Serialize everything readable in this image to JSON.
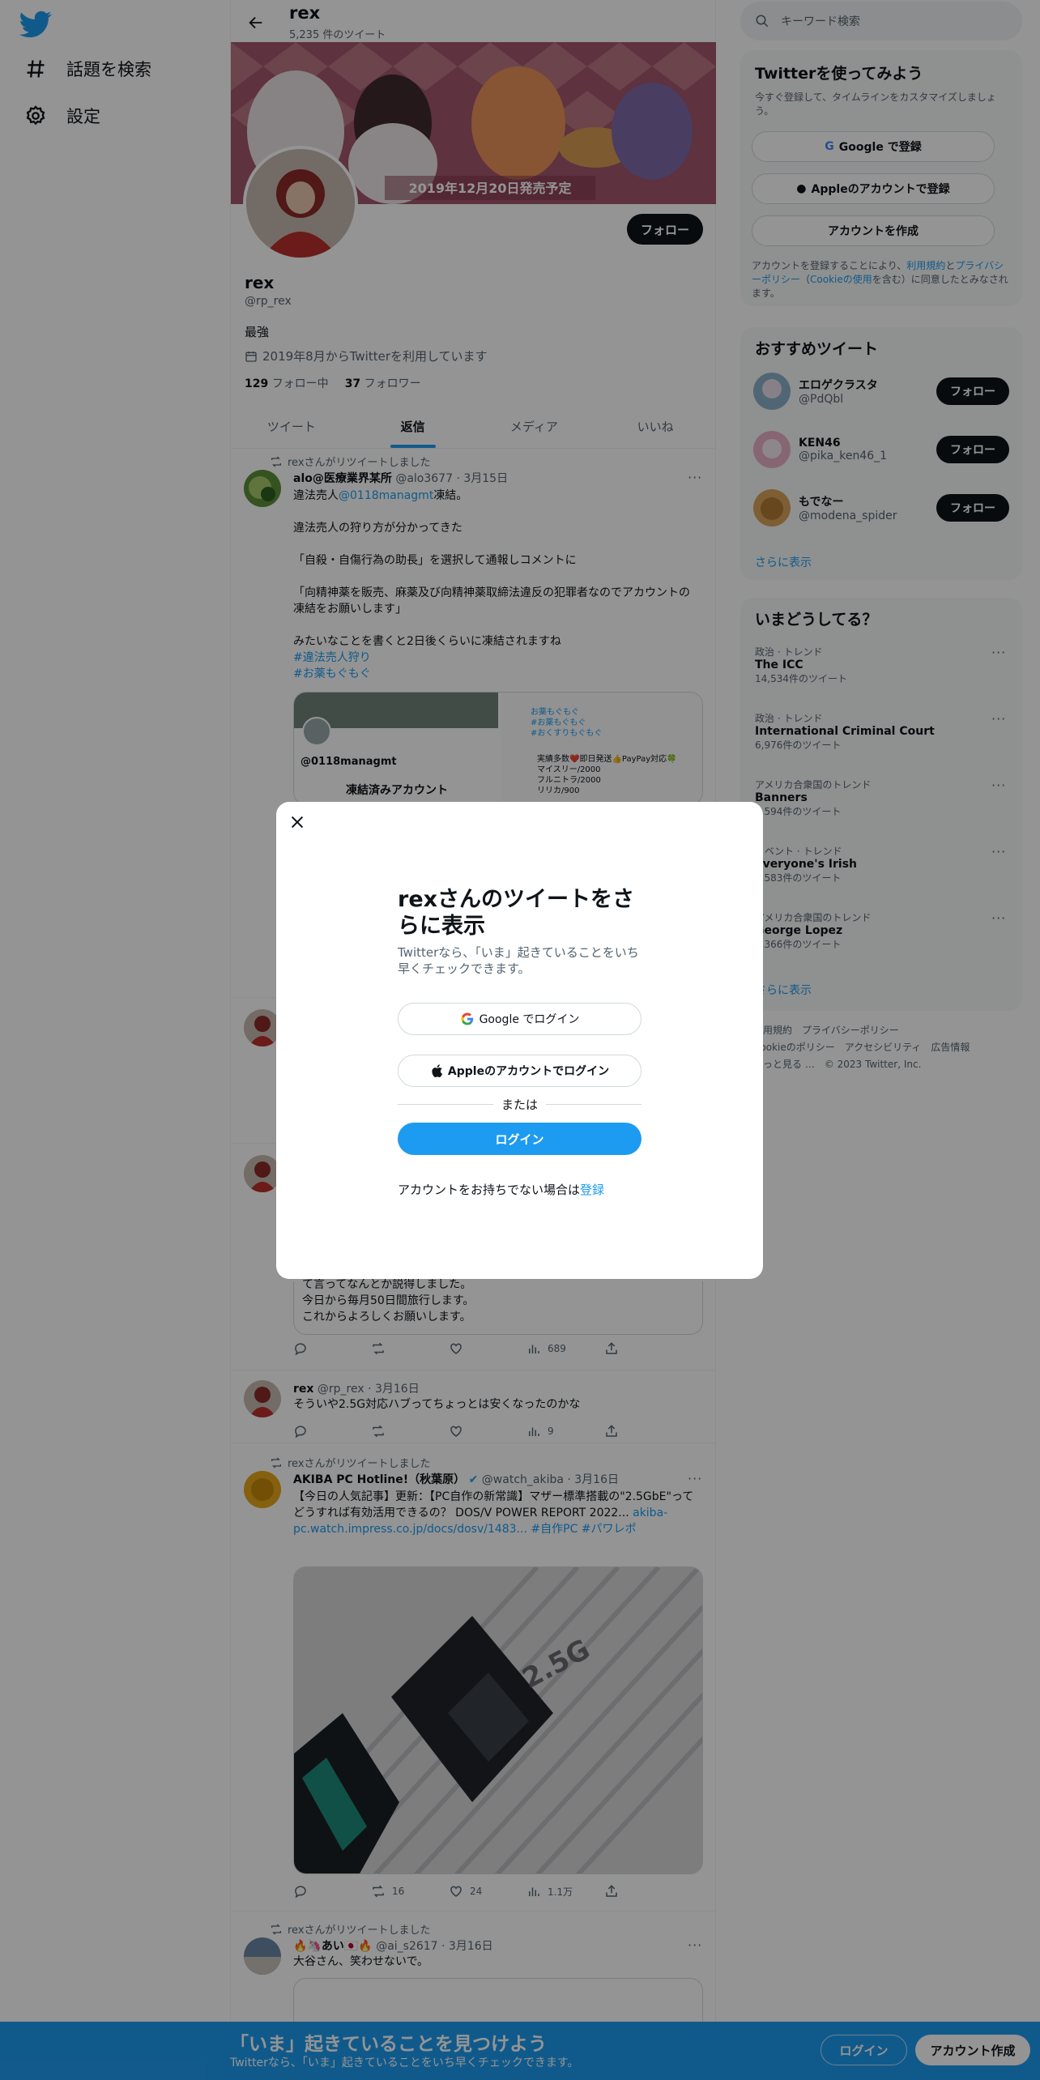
{
  "nav": {
    "explore_label": "話題を検索",
    "settings_label": "設定"
  },
  "header": {
    "title": "rex",
    "tweet_count": "5,235 件のツイート"
  },
  "banner": {
    "caption": "2019年12月20日発売予定"
  },
  "profile": {
    "follow_label": "フォロー",
    "name": "rex",
    "handle": "@rp_rex",
    "bio": "最強",
    "joined": "2019年8月からTwitterを利用しています",
    "following_count": "129",
    "following_label": "フォロー中",
    "followers_count": "37",
    "followers_label": "フォロワー"
  },
  "tabs": [
    {
      "label": "ツイート"
    },
    {
      "label": "返信"
    },
    {
      "label": "メディア"
    },
    {
      "label": "いいね"
    }
  ],
  "tweets": [
    {
      "retweet_by": "rexさんがリツイートしました",
      "name": "alo@医療業界某所",
      "handle_date": "@alo3677 · 3月15日",
      "text_pre": "違法売人",
      "mention": "@0118managmt",
      "text_post": "凍結。",
      "body": "違法売人の狩り方が分かってきた\n\n「自殺・自傷行為の助長」を選択して通報しコメントに\n\n「向精神薬を販売、麻薬及び向精神薬取締法違反の犯罪者なのでアカウントの凍結をお願いします」\n\nみたいなことを書くと2日後くらいに凍結されますね",
      "hashtag1": "#違法売人狩り",
      "hashtag2": "#お薬もぐもぐ",
      "image_handle": "@0118managmt",
      "image_suspended": "凍結済みアカウント",
      "image_tags": "お薬もぐもぐ\n#お薬もぐもぐ\n#おくすりもぐもぐ",
      "image_post": "実績多数❤️即日発送👍PayPay対応🍀\nマイスリー/2000\nフルニトラ/2000\nリリカ/900"
    },
    {
      "body_tail": "て言ってなんとか説得しました。\n今日から毎月50日間旅行します。\nこれからよろしくお願いします。",
      "views": "689"
    },
    {
      "name": "rex",
      "handle_date": "@rp_rex · 3月16日",
      "body": "そういや2.5G対応ハブってちょっとは安くなったのかな",
      "views": "9"
    },
    {
      "retweet_by": "rexさんがリツイートしました",
      "name": "AKIBA PC Hotline!（秋葉原）",
      "handle_date": "@watch_akiba · 3月16日",
      "body": "【今日の人気記事】更新：【PC自作の新常識】マザー標準搭載の\"2.5GbE\"ってどうすれば有効活用できるの？ DOS/V POWER REPORT 2022...",
      "link": "akiba-pc.watch.impress.co.jp/docs/dosv/1483...",
      "hashtags": "#自作PC #パワレポ",
      "retweets": "16",
      "likes": "24",
      "views": "1.1万",
      "image_text": "2.5G"
    },
    {
      "retweet_by": "rexさんがリツイートしました",
      "name": "🔥🦄あい🇯🇵🔥",
      "handle_date": "@ai_s2617 · 3月16日",
      "body": "大谷さん、笑わせないで。"
    }
  ],
  "right": {
    "search_placeholder": "キーワード検索",
    "signup_card": {
      "title": "Twitterを使ってみよう",
      "subtitle": "今すぐ登録して、タイムラインをカスタマイズしましょう。",
      "google": "Google で登録",
      "apple": "Appleのアカウントで登録",
      "create": "アカウントを作成",
      "terms_pre": "アカウントを登録することにより、",
      "terms_link": "利用規約",
      "terms_mid": "と",
      "privacy_link": "プライバシーポリシー",
      "terms_mid2": "（",
      "cookie_link": "Cookieの使用",
      "terms_post": "を含む）に同意したとみなされます。"
    },
    "recommended": {
      "title": "おすすめツイート",
      "users": [
        {
          "name": "エロゲクラスタ",
          "handle": "@PdQbl",
          "follow": "フォロー"
        },
        {
          "name": "KEN46",
          "handle": "@pika_ken46_1",
          "follow": "フォロー"
        },
        {
          "name": "もでなー",
          "handle": "@modena_spider",
          "follow": "フォロー"
        }
      ],
      "more": "さらに表示"
    },
    "trends": {
      "title": "いまどうしてる？",
      "items": [
        {
          "meta": "政治 · トレンド",
          "name": "The ICC",
          "count": "14,534件のツイート"
        },
        {
          "meta": "政治 · トレンド",
          "name": "International Criminal Court",
          "count": "6,976件のツイート"
        },
        {
          "meta": "アメリカ合衆国のトレンド",
          "name": "Banners",
          "count": "1,594件のツイート"
        },
        {
          "meta": "イベント · トレンド",
          "name": "Everyone's Irish",
          "count": "1,583件のツイート"
        },
        {
          "meta": "アメリカ合衆国のトレンド",
          "name": "George Lopez",
          "count": "1,366件のツイート"
        }
      ],
      "more": "さらに表示"
    },
    "footer": {
      "line1": "利用規約　プライバシーポリシー",
      "line2": "Cookieのポリシー　アクセシビリティ　広告情報",
      "line3": "もっと見る …　© 2023 Twitter, Inc."
    }
  },
  "modal": {
    "title": "rexさんのツイートをさらに表示",
    "subtitle": "Twitterなら、「いま」起きていることをいち早くチェックできます。",
    "google": "Google でログイン",
    "apple": "Appleのアカウントでログイン",
    "or": "または",
    "login": "ログイン",
    "signup_pre": "アカウントをお持ちでない場合は",
    "signup_link": "登録"
  },
  "bottom_bar": {
    "title": "「いま」起きていることを見つけよう",
    "subtitle": "Twitterなら、「いま」起きていることをいち早くチェックできます。",
    "login": "ログイン",
    "signup": "アカウント作成"
  },
  "colors": {
    "accent": "#1d9bf0",
    "text": "#0f1419",
    "muted": "#536471",
    "overlay": "rgba(0,0,0,0.42)"
  }
}
